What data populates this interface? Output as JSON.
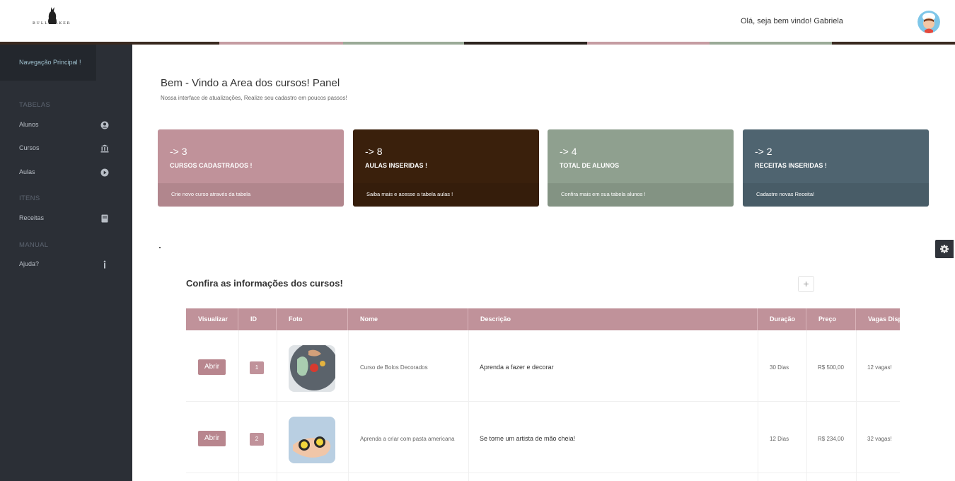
{
  "header": {
    "logo_text": "BULL BAKER",
    "greeting": "Olá, seja bem vindo! Gabriela",
    "avatar_icon": "chef-avatar-icon",
    "stripe_colors": [
      "#3a2a20",
      "#c59ca2",
      "#9aaa97",
      "#2d241f",
      "#c59ca2",
      "#9aaa97",
      "#3a2a20"
    ]
  },
  "sidebar": {
    "title": "Navegação Principal !",
    "sections": [
      {
        "label": "TABELAS",
        "items": [
          {
            "label": "Alunos",
            "icon": "user-circle-icon"
          },
          {
            "label": "Cursos",
            "icon": "bank-icon"
          },
          {
            "label": "Aulas",
            "icon": "play-circle-icon"
          }
        ]
      },
      {
        "label": "ITENS",
        "items": [
          {
            "label": "Receitas",
            "icon": "book-icon"
          }
        ]
      },
      {
        "label": "MANUAL",
        "items": [
          {
            "label": "Ajuda?",
            "icon": "info-icon"
          }
        ]
      }
    ]
  },
  "main": {
    "title": "Bem - Vindo a Area dos cursos! Panel",
    "subtitle": "Nossa interface de atualizações, Realize seu cadastro em poucos passos!",
    "cards": [
      {
        "value": "-> 3",
        "label": "CURSOS CADASTRADOS !",
        "footer": "Crie novo curso através da tabela",
        "color": "#c0929a"
      },
      {
        "value": "-> 8",
        "label": "AULAS INSERIDAS !",
        "footer": "Saiba mais e acesse a tabela aulas !",
        "color": "#3a200c"
      },
      {
        "value": "-> 4",
        "label": "TOTAL DE ALUNOS",
        "footer": "Confira mais em sua tabela alunos !",
        "color": "#8fa08f"
      },
      {
        "value": "-> 2",
        "label": "RECEITAS INSERIDAS !",
        "footer": "Cadastre novas Receita!",
        "color": "#4f6470"
      }
    ],
    "dot_text": ".",
    "table_title": "Confira as informações dos cursos!",
    "add_label": "+",
    "columns": [
      "Visualizar",
      "ID",
      "Foto",
      "Nome",
      "Descrição",
      "Duração",
      "Preço",
      "Vagas Disponíveis"
    ],
    "rows": [
      {
        "action": "Abrir",
        "id": "1",
        "name": "Curso de Bolos Decorados",
        "description": "Aprenda a fazer e decorar",
        "duration": "30 Dias",
        "price": "R$ 500,00",
        "seats": "12 vagas!"
      },
      {
        "action": "Abrir",
        "id": "2",
        "name": "Aprenda a criar com pasta americana",
        "description": "Se torne um artista de mão cheia!",
        "duration": "12 Dias",
        "price": "R$ 234,00",
        "seats": "32 vagas!"
      }
    ]
  }
}
